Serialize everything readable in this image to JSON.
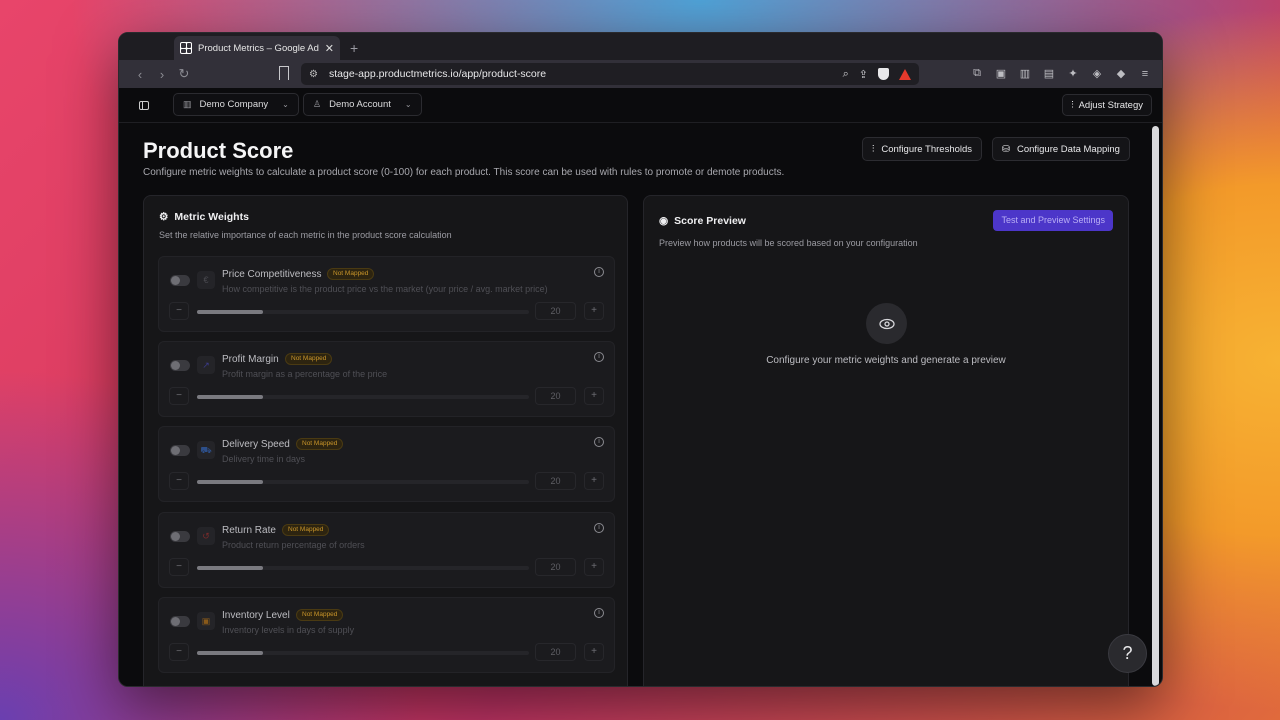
{
  "browser": {
    "tab_title": "Product Metrics – Google Ads",
    "url": "stage-app.productmetrics.io/app/product-score"
  },
  "topbar": {
    "company": "Demo Company",
    "account": "Demo Account",
    "adjust_strategy": "Adjust Strategy"
  },
  "page": {
    "title": "Product Score",
    "subtitle": "Configure metric weights to calculate a product score (0-100) for each product. This score can be used with rules to promote or demote products.",
    "configure_thresholds": "Configure Thresholds",
    "configure_data_mapping": "Configure Data Mapping"
  },
  "weights": {
    "title": "Metric Weights",
    "description": "Set the relative importance of each metric in the product score calculation",
    "not_mapped": "Not Mapped",
    "metrics": [
      {
        "name": "Price Competitiveness",
        "description": "How competitive is the product price vs the market (your price / avg. market price)",
        "value": "20",
        "icon": "euro-icon",
        "icon_color": "#4a4a50",
        "weight_fraction": 0.2
      },
      {
        "name": "Profit Margin",
        "description": "Profit margin as a percentage of the price",
        "value": "20",
        "icon": "trend-icon",
        "icon_color": "#3b3b8a",
        "weight_fraction": 0.2
      },
      {
        "name": "Delivery Speed",
        "description": "Delivery time in days",
        "value": "20",
        "icon": "truck-icon",
        "icon_color": "#2d4f8a",
        "weight_fraction": 0.2
      },
      {
        "name": "Return Rate",
        "description": "Product return percentage of orders",
        "value": "20",
        "icon": "return-icon",
        "icon_color": "#7a2a2a",
        "weight_fraction": 0.2
      },
      {
        "name": "Inventory Level",
        "description": "Inventory levels in days of supply",
        "value": "20",
        "icon": "box-icon",
        "icon_color": "#8a5a1a",
        "weight_fraction": 0.2
      }
    ]
  },
  "preview": {
    "title": "Score Preview",
    "description": "Preview how products will be scored based on your configuration",
    "test_button": "Test and Preview Settings",
    "empty_text": "Configure your metric weights and generate a preview"
  },
  "help": "?"
}
